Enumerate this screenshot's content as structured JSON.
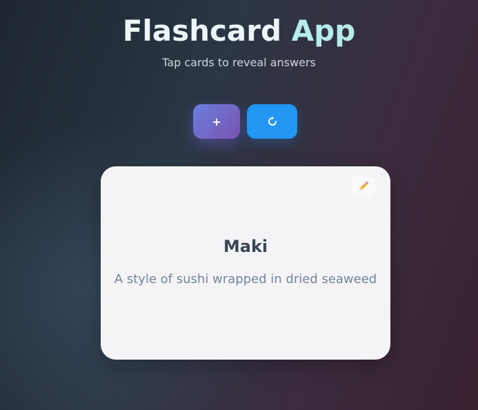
{
  "header": {
    "title_part1": "Flashcard",
    "title_part2": "App",
    "subtitle": "Tap cards to reveal answers"
  },
  "toolbar": {
    "add_label": "+",
    "reset_icon": "refresh-icon"
  },
  "card": {
    "term": "Maki",
    "definition": "A style of sushi wrapped in dried seaweed",
    "edit_icon": "pencil-icon"
  },
  "colors": {
    "title_primary": "#ecf6f8",
    "title_accent": "#b6ecea",
    "add_button_gradient_start": "#6a7fde",
    "add_button_gradient_end": "#7a52b0",
    "reset_button": "#2196f3",
    "card_background": "#f4f4f6",
    "term_text": "#3a4658",
    "definition_text": "#75839a"
  }
}
